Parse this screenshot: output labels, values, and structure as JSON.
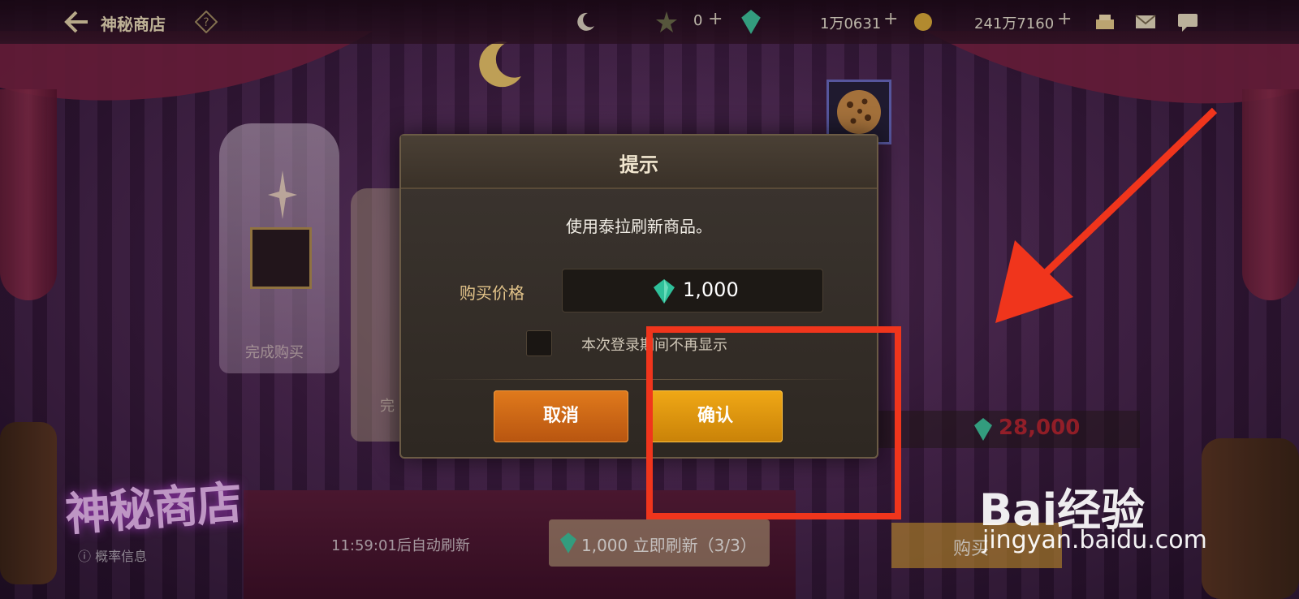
{
  "topbar": {
    "title": "神秘商店",
    "currency_1": "0",
    "currency_2": "1万0631",
    "currency_3": "241万7160"
  },
  "background": {
    "card_1_label": "完成购买",
    "card_2_label": "完",
    "price_strip_value": "28,000",
    "logo_text": "神秘商店",
    "rate_label": "概率信息",
    "auto_refresh": "11:59:01后自动刷新",
    "refresh_button": "1,000 立即刷新（3/3）",
    "buy_button": "购买"
  },
  "dialog": {
    "title": "提示",
    "message": "使用泰拉刷新商品。",
    "price_label": "购买价格",
    "price_value": "1,000",
    "checkbox_label": "本次登录期间不再显示",
    "cancel_label": "取消",
    "confirm_label": "确认"
  },
  "watermark": {
    "brand": "Bai经验",
    "url": "jingyan.baidu.com"
  },
  "colors": {
    "cancel_button": "#d0691a",
    "confirm_button": "#e59a10",
    "annotation_red": "#f0351c"
  }
}
